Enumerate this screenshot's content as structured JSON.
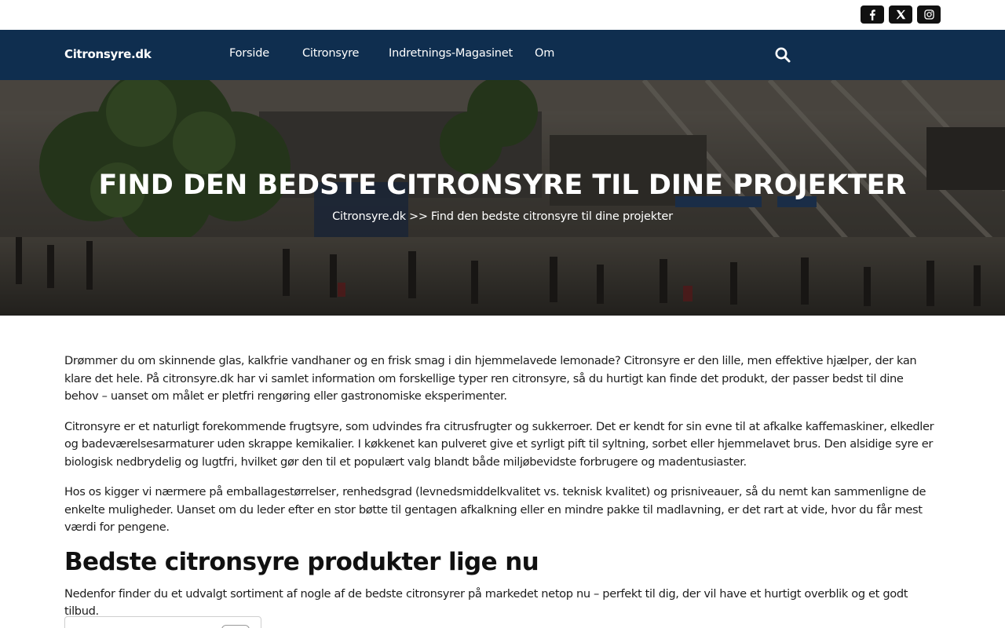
{
  "social": {
    "facebook_icon": "facebook-icon",
    "x_icon": "x-twitter-icon",
    "instagram_icon": "instagram-icon"
  },
  "nav": {
    "brand": "Citronsyre.dk",
    "items": [
      {
        "label": "Forside"
      },
      {
        "label": "Citronsyre"
      },
      {
        "label": "Indretnings-Magasinet"
      },
      {
        "label": "Om"
      }
    ],
    "search_icon": "search-icon"
  },
  "hero": {
    "title": "FIND DEN BEDSTE CITRONSYRE TIL DINE PROJEKTER",
    "breadcrumb": {
      "home": "Citronsyre.dk",
      "separator": ">>",
      "current": "Find den bedste citronsyre til dine projekter"
    }
  },
  "article": {
    "paragraphs": [
      "Drømmer du om skinnende glas, kalkfrie vandhaner og en frisk smag i din hjemmelavede lemonade? Citronsyre er den lille, men effektive hjælper, der kan klare det hele. På citronsyre.dk har vi samlet information om forskellige typer ren citronsyre, så du hurtigt kan finde det produkt, der passer bedst til dine behov – uanset om målet er pletfri rengøring eller gastronomiske eksperimenter.",
      "Citronsyre er et naturligt forekommende frugtsyre, som udvindes fra citrusfrugter og sukkerroer. Det er kendt for sin evne til at afkalke kaffemaskiner, elkedler og badeværelsesarmaturer uden skrappe kemikalier. I køkkenet kan pulveret give et syrligt pift til syltning, sorbet eller hjemmelavet brus. Den alsidige syre er biologisk nedbrydelig og lugtfri, hvilket gør den til et populært valg blandt både miljøbevidste forbrugere og madentusiaster.",
      "Hos os kigger vi nærmere på emballagestørrelser, renhedsgrad (levnedsmiddelkvalitet vs. teknisk kvalitet) og prisniveauer, så du nemt kan sammenligne de enkelte muligheder. Uanset om du leder efter en stor bøtte til gentagen afkalkning eller en mindre pakke til madlavning, er det rart at vide, hvor du får mest værdi for pengene."
    ],
    "heading": "Bedste citronsyre produkter lige nu",
    "lead": "Nedenfor finder du et udvalgt sortiment af nogle af de bedste citronsyrer på markedet netop nu – perfekt til dig, der vil have et hurtigt overblik og et godt tilbud."
  },
  "colors": {
    "nav_bg": "#0f2e4f",
    "social_bg": "#111111",
    "text": "#1d1d1d"
  }
}
